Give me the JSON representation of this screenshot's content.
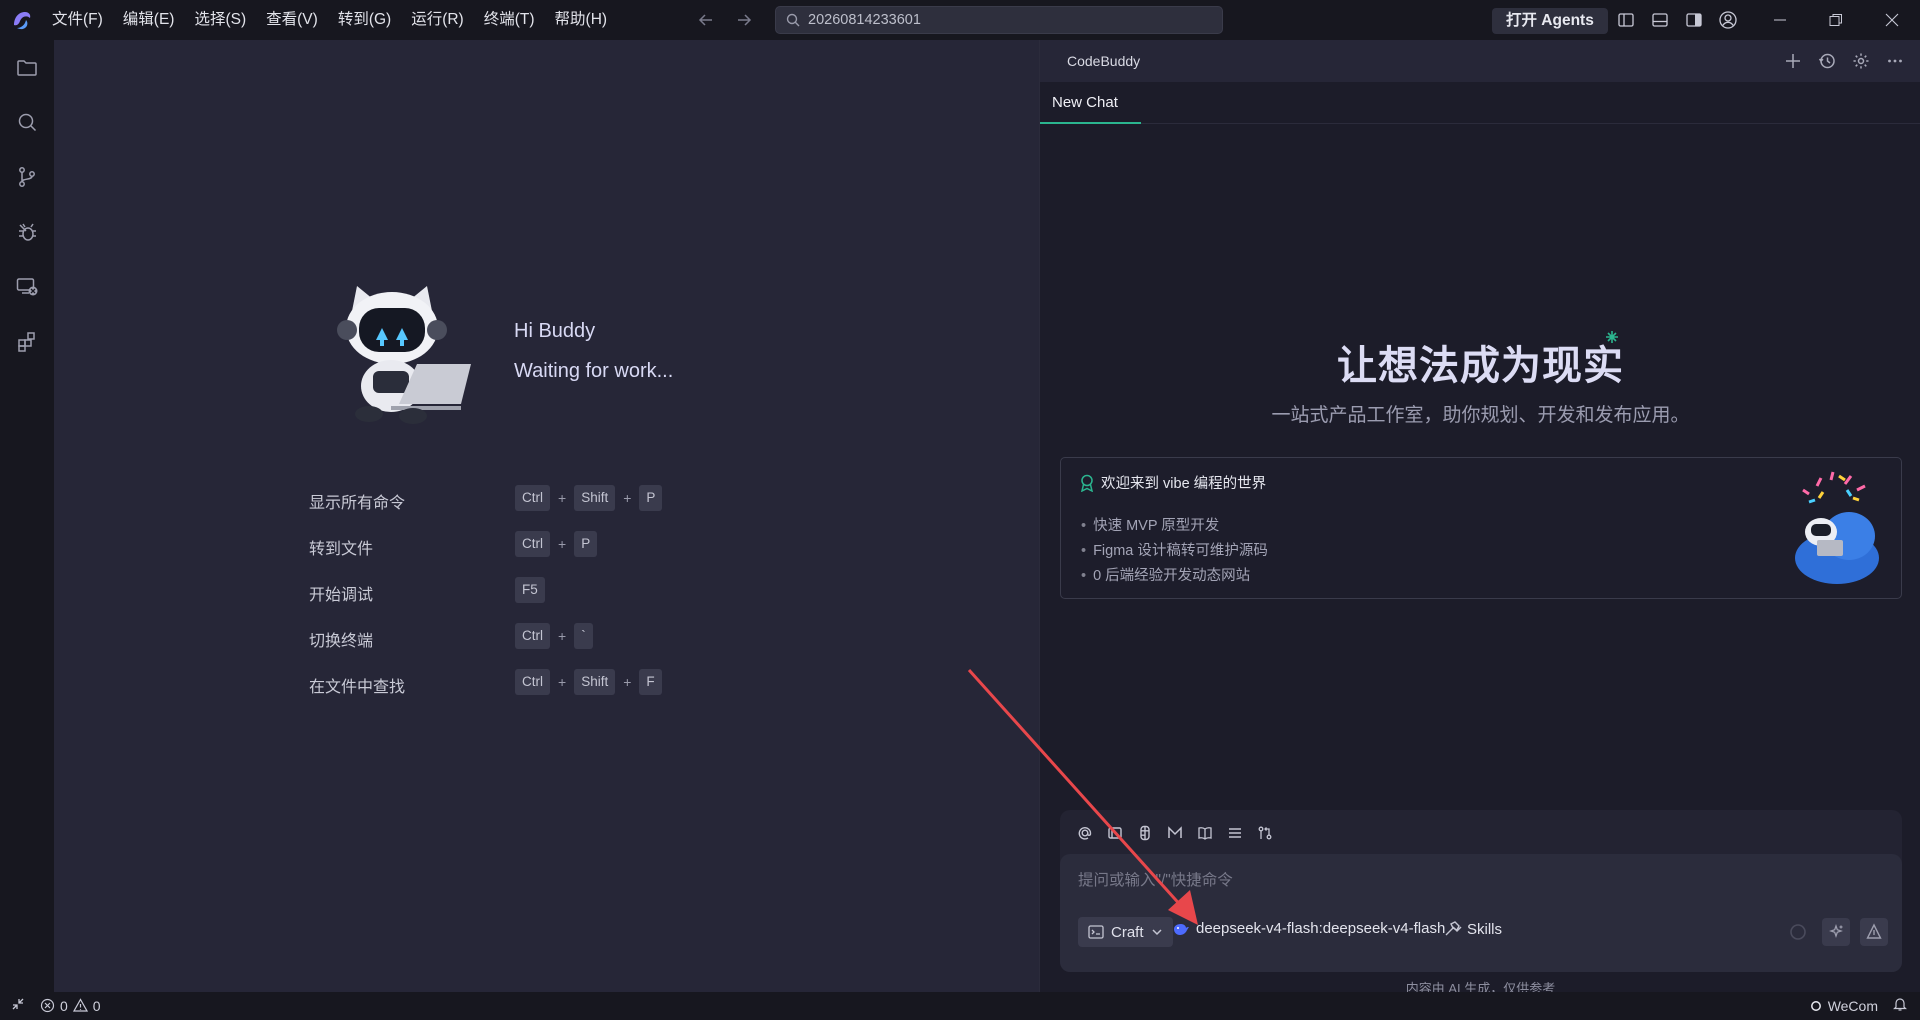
{
  "titlebar": {
    "menu": [
      "文件(F)",
      "编辑(E)",
      "选择(S)",
      "查看(V)",
      "转到(G)",
      "运行(R)",
      "终端(T)",
      "帮助(H)"
    ],
    "search_value": "20260814233601",
    "agents_button": "打开 Agents"
  },
  "activitybar": {
    "icons": [
      "explorer-icon",
      "search-icon",
      "source-control-icon",
      "debug-icon",
      "remote-explorer-icon",
      "extensions-icon"
    ]
  },
  "editor": {
    "greeting": "Hi Buddy",
    "status": "Waiting for work...",
    "shortcuts": [
      {
        "label": "显示所有命令",
        "keys": [
          "Ctrl",
          "Shift",
          "P"
        ]
      },
      {
        "label": "转到文件",
        "keys": [
          "Ctrl",
          "P"
        ]
      },
      {
        "label": "开始调试",
        "keys": [
          "F5"
        ]
      },
      {
        "label": "切换终端",
        "keys": [
          "Ctrl",
          "`"
        ]
      },
      {
        "label": "在文件中查找",
        "keys": [
          "Ctrl",
          "Shift",
          "F"
        ]
      }
    ],
    "plus": "+"
  },
  "chat": {
    "panel_title": "CodeBuddy",
    "tab": "New Chat",
    "hero_title": "让想法成为现实",
    "hero_subtitle": "一站式产品工作室，助你规划、开发和发布应用。",
    "card": {
      "title": "欢迎来到 vibe 编程的世界",
      "items": [
        "快速 MVP 原型开发",
        "Figma 设计稿转可维护源码",
        "0 后端经验开发动态网站"
      ]
    },
    "input": {
      "placeholder": "提问或输入\"/\"快捷命令",
      "mode": "Craft",
      "model": "deepseek-v4-flash:deepseek-v4-flash",
      "skills": "Skills"
    },
    "disclaimer": "内容由 AI 生成，仅供参考"
  },
  "statusbar": {
    "errors": "0",
    "warnings": "0",
    "account": "WeCom"
  },
  "colors": {
    "accent": "#2bb58f",
    "annotation_arrow": "#e8474b"
  }
}
